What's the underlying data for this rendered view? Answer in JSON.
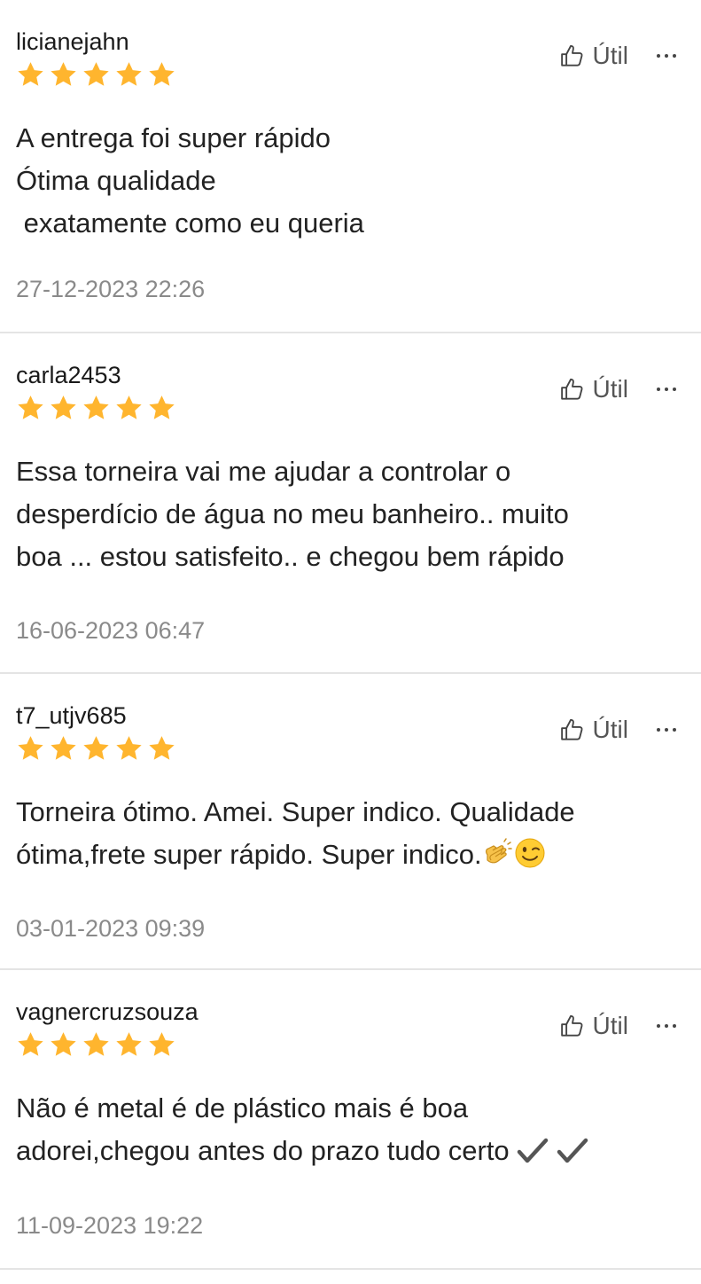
{
  "reviews": [
    {
      "username": "licianejahn",
      "rating": 5,
      "useful_label": "Útil",
      "text_lines": [
        "A entrega foi super rápido",
        "Ótima qualidade",
        " exatamente como eu queria"
      ],
      "date": "27-12-2023 22:26"
    },
    {
      "username": "carla2453",
      "rating": 5,
      "useful_label": "Útil",
      "text_lines": [
        "Essa torneira vai me ajudar a controlar o",
        "desperdício de água no meu banheiro.. muito",
        "boa ... estou satisfeito.. e chegou bem rápido"
      ],
      "date": "16-06-2023 06:47"
    },
    {
      "username": "t7_utjv685",
      "rating": 5,
      "useful_label": "Útil",
      "text_lines": [
        "Torneira ótimo. Amei. Super indico. Qualidade",
        "ótima,frete super rápido. Super indico."
      ],
      "text_emojis": [
        "clapping-hands-emoji",
        "winking-face-emoji"
      ],
      "date": "03-01-2023 09:39"
    },
    {
      "username": "vagnercruzsouza",
      "rating": 5,
      "useful_label": "Útil",
      "text_lines": [
        "Não é metal é de plástico mais é boa",
        "adorei,chegou antes do prazo tudo certo"
      ],
      "text_emojis": [
        "check-mark-icon",
        "check-mark-icon"
      ],
      "date": "11-09-2023 19:22"
    }
  ],
  "colors": {
    "star": "#FFB52E",
    "text": "#222222",
    "date": "#8A8A8A",
    "useful": "#555555",
    "divider": "#E4E4E4"
  }
}
